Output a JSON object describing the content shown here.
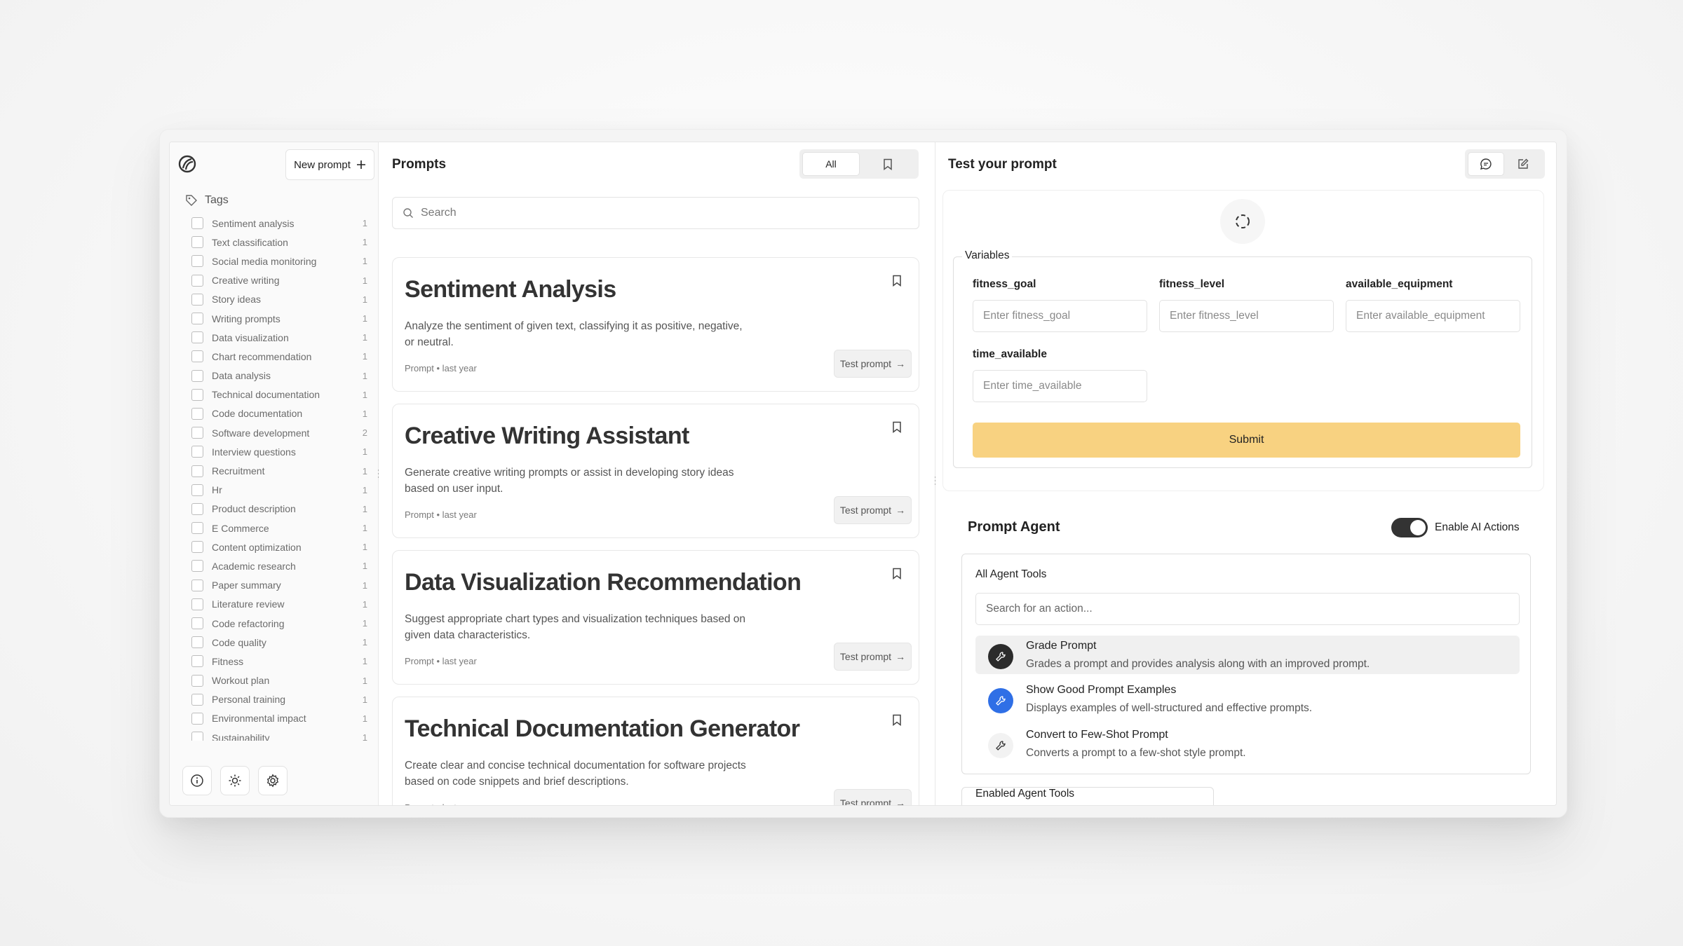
{
  "sidebar": {
    "new_prompt_label": "New prompt",
    "tags_heading": "Tags",
    "tags": [
      {
        "label": "Sentiment analysis",
        "count": "1"
      },
      {
        "label": "Text classification",
        "count": "1"
      },
      {
        "label": "Social media monitoring",
        "count": "1"
      },
      {
        "label": "Creative writing",
        "count": "1"
      },
      {
        "label": "Story ideas",
        "count": "1"
      },
      {
        "label": "Writing prompts",
        "count": "1"
      },
      {
        "label": "Data visualization",
        "count": "1"
      },
      {
        "label": "Chart recommendation",
        "count": "1"
      },
      {
        "label": "Data analysis",
        "count": "1"
      },
      {
        "label": "Technical documentation",
        "count": "1"
      },
      {
        "label": "Code documentation",
        "count": "1"
      },
      {
        "label": "Software development",
        "count": "2"
      },
      {
        "label": "Interview questions",
        "count": "1"
      },
      {
        "label": "Recruitment",
        "count": "1"
      },
      {
        "label": "Hr",
        "count": "1"
      },
      {
        "label": "Product description",
        "count": "1"
      },
      {
        "label": "E Commerce",
        "count": "1"
      },
      {
        "label": "Content optimization",
        "count": "1"
      },
      {
        "label": "Academic research",
        "count": "1"
      },
      {
        "label": "Paper summary",
        "count": "1"
      },
      {
        "label": "Literature review",
        "count": "1"
      },
      {
        "label": "Code refactoring",
        "count": "1"
      },
      {
        "label": "Code quality",
        "count": "1"
      },
      {
        "label": "Fitness",
        "count": "1"
      },
      {
        "label": "Workout plan",
        "count": "1"
      },
      {
        "label": "Personal training",
        "count": "1"
      },
      {
        "label": "Environmental impact",
        "count": "1"
      },
      {
        "label": "Sustainability",
        "count": "1"
      }
    ]
  },
  "prompts": {
    "title": "Prompts",
    "filter_all_label": "All",
    "search_placeholder": "Search",
    "cards": [
      {
        "title": "Sentiment Analysis",
        "description": "Analyze the sentiment of given text, classifying it as positive, negative, or neutral.",
        "meta": "Prompt • last year",
        "action": "Test prompt"
      },
      {
        "title": "Creative Writing Assistant",
        "description": "Generate creative writing prompts or assist in developing story ideas based on user input.",
        "meta": "Prompt • last year",
        "action": "Test prompt"
      },
      {
        "title": "Data Visualization Recommendation",
        "description": "Suggest appropriate chart types and visualization techniques based on given data characteristics.",
        "meta": "Prompt • last year",
        "action": "Test prompt"
      },
      {
        "title": "Technical Documentation Generator",
        "description": "Create clear and concise technical documentation for software projects based on code snippets and brief descriptions.",
        "meta": "Prompt • last year",
        "action": "Test prompt"
      }
    ]
  },
  "test": {
    "title": "Test your prompt",
    "variables_legend": "Variables",
    "variables": [
      {
        "label": "fitness_goal",
        "placeholder": "Enter fitness_goal"
      },
      {
        "label": "fitness_level",
        "placeholder": "Enter fitness_level"
      },
      {
        "label": "available_equipment",
        "placeholder": "Enter available_equipment"
      },
      {
        "label": "time_available",
        "placeholder": "Enter time_available"
      }
    ],
    "submit_label": "Submit",
    "submit_color": "#f8d281"
  },
  "agent": {
    "title": "Prompt Agent",
    "toggle_label": "Enable AI Actions",
    "toggle_on": true,
    "all_tools_heading": "All Agent Tools",
    "tools_search_placeholder": "Search for an action...",
    "tools": [
      {
        "name": "Grade Prompt",
        "description": "Grades a prompt and provides analysis along with an improved prompt.",
        "icon": "wrench-icon",
        "icon_bg": "#2b2b2b"
      },
      {
        "name": "Show Good Prompt Examples",
        "description": "Displays examples of well-structured and effective prompts.",
        "icon": "wrench-icon",
        "icon_bg": "#2f6fe6"
      },
      {
        "name": "Convert to Few-Shot Prompt",
        "description": "Converts a prompt to a few-shot style prompt.",
        "icon": "wrench-icon",
        "icon_bg": "#f2f2f2"
      }
    ],
    "enabled_tools_heading": "Enabled Agent Tools"
  }
}
